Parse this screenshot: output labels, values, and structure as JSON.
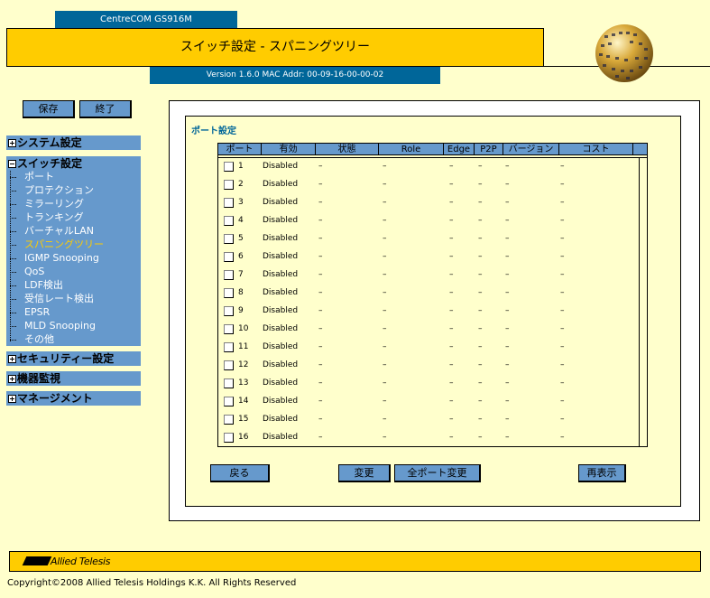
{
  "header": {
    "model": "CentreCOM GS916M",
    "title": "スイッチ設定 - スパニングツリー",
    "version": "Version 1.6.0 MAC Addr: 00-09-16-00-00-02"
  },
  "toolbar": {
    "save_label": "保存",
    "exit_label": "終了"
  },
  "sidebar": {
    "system": "システム設定",
    "switch": "スイッチ設定",
    "switch_items": [
      "ポート",
      "プロテクション",
      "ミラーリング",
      "トランキング",
      "バーチャルLAN",
      "スパニングツリー",
      "IGMP Snooping",
      "QoS",
      "LDF検出",
      "受信レート検出",
      "EPSR",
      "MLD Snooping",
      "その他"
    ],
    "security": "セキュリティー設定",
    "monitor": "機器監視",
    "management": "マネージメント"
  },
  "section_title": "ポート設定",
  "table": {
    "columns": [
      "ポート",
      "有効",
      "状態",
      "Role",
      "Edge",
      "P2P",
      "バージョン",
      "コスト"
    ],
    "rows": [
      {
        "port": "1",
        "enabled": "Disabled",
        "state": "–",
        "role": "–",
        "edge": "–",
        "p2p": "–",
        "version": "–",
        "cost": "–"
      },
      {
        "port": "2",
        "enabled": "Disabled",
        "state": "–",
        "role": "–",
        "edge": "–",
        "p2p": "–",
        "version": "–",
        "cost": "–"
      },
      {
        "port": "3",
        "enabled": "Disabled",
        "state": "–",
        "role": "–",
        "edge": "–",
        "p2p": "–",
        "version": "–",
        "cost": "–"
      },
      {
        "port": "4",
        "enabled": "Disabled",
        "state": "–",
        "role": "–",
        "edge": "–",
        "p2p": "–",
        "version": "–",
        "cost": "–"
      },
      {
        "port": "5",
        "enabled": "Disabled",
        "state": "–",
        "role": "–",
        "edge": "–",
        "p2p": "–",
        "version": "–",
        "cost": "–"
      },
      {
        "port": "6",
        "enabled": "Disabled",
        "state": "–",
        "role": "–",
        "edge": "–",
        "p2p": "–",
        "version": "–",
        "cost": "–"
      },
      {
        "port": "7",
        "enabled": "Disabled",
        "state": "–",
        "role": "–",
        "edge": "–",
        "p2p": "–",
        "version": "–",
        "cost": "–"
      },
      {
        "port": "8",
        "enabled": "Disabled",
        "state": "–",
        "role": "–",
        "edge": "–",
        "p2p": "–",
        "version": "–",
        "cost": "–"
      },
      {
        "port": "9",
        "enabled": "Disabled",
        "state": "–",
        "role": "–",
        "edge": "–",
        "p2p": "–",
        "version": "–",
        "cost": "–"
      },
      {
        "port": "10",
        "enabled": "Disabled",
        "state": "–",
        "role": "–",
        "edge": "–",
        "p2p": "–",
        "version": "–",
        "cost": "–"
      },
      {
        "port": "11",
        "enabled": "Disabled",
        "state": "–",
        "role": "–",
        "edge": "–",
        "p2p": "–",
        "version": "–",
        "cost": "–"
      },
      {
        "port": "12",
        "enabled": "Disabled",
        "state": "–",
        "role": "–",
        "edge": "–",
        "p2p": "–",
        "version": "–",
        "cost": "–"
      },
      {
        "port": "13",
        "enabled": "Disabled",
        "state": "–",
        "role": "–",
        "edge": "–",
        "p2p": "–",
        "version": "–",
        "cost": "–"
      },
      {
        "port": "14",
        "enabled": "Disabled",
        "state": "–",
        "role": "–",
        "edge": "–",
        "p2p": "–",
        "version": "–",
        "cost": "–"
      },
      {
        "port": "15",
        "enabled": "Disabled",
        "state": "–",
        "role": "–",
        "edge": "–",
        "p2p": "–",
        "version": "–",
        "cost": "–"
      },
      {
        "port": "16",
        "enabled": "Disabled",
        "state": "–",
        "role": "–",
        "edge": "–",
        "p2p": "–",
        "version": "–",
        "cost": "–"
      }
    ]
  },
  "buttons": {
    "back": "戻る",
    "change": "変更",
    "change_all": "全ポート変更",
    "refresh": "再表示"
  },
  "footer": {
    "logo": "Allied Telesis",
    "copyright": "Copyright©2008 Allied Telesis Holdings K.K. All Rights Reserved"
  },
  "colors": {
    "accent": "#ffcc00",
    "nav": "#6699cc",
    "header_blue": "#006699",
    "background": "#ffffcc",
    "active_item": "#ffcc00"
  }
}
